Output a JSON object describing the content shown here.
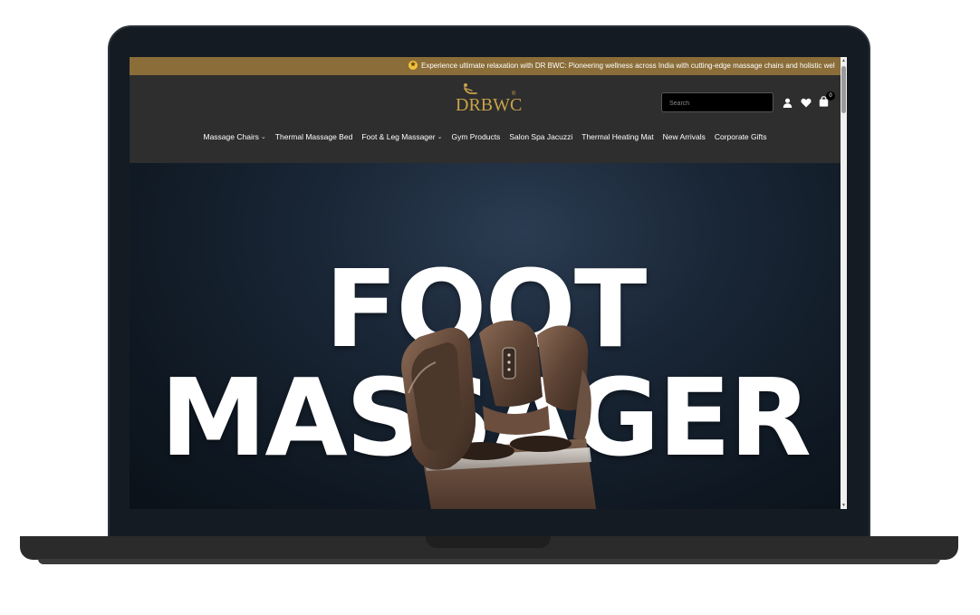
{
  "announcement": {
    "text": "Experience ultimate relaxation with DR BWC: Pioneering wellness across India with cutting-edge massage chairs and holistic wel",
    "icon": "star-coin-icon"
  },
  "header": {
    "logo_text": "DRBWC",
    "logo_reg": "®",
    "search": {
      "placeholder": "Search",
      "value": ""
    },
    "icons": [
      "user-icon",
      "heart-icon",
      "cart-icon"
    ],
    "cart_count": "0"
  },
  "nav": {
    "items": [
      {
        "label": "Massage Chairs",
        "dropdown": true
      },
      {
        "label": "Thermal Massage Bed",
        "dropdown": false
      },
      {
        "label": "Foot & Leg Massager",
        "dropdown": true
      },
      {
        "label": "Gym Products",
        "dropdown": false
      },
      {
        "label": "Salon Spa Jacuzzi",
        "dropdown": false
      },
      {
        "label": "Thermal Heating Mat",
        "dropdown": false
      },
      {
        "label": "New Arrivals",
        "dropdown": false
      },
      {
        "label": "Corporate Gifts",
        "dropdown": false
      }
    ]
  },
  "hero": {
    "line1": "FOOT",
    "line2": "MASSAGER"
  },
  "colors": {
    "announcement_bg": "#8a6d38",
    "header_bg": "#2e2e2e",
    "brand_gold": "#c9a24a",
    "whatsapp": "#1f8f43"
  }
}
